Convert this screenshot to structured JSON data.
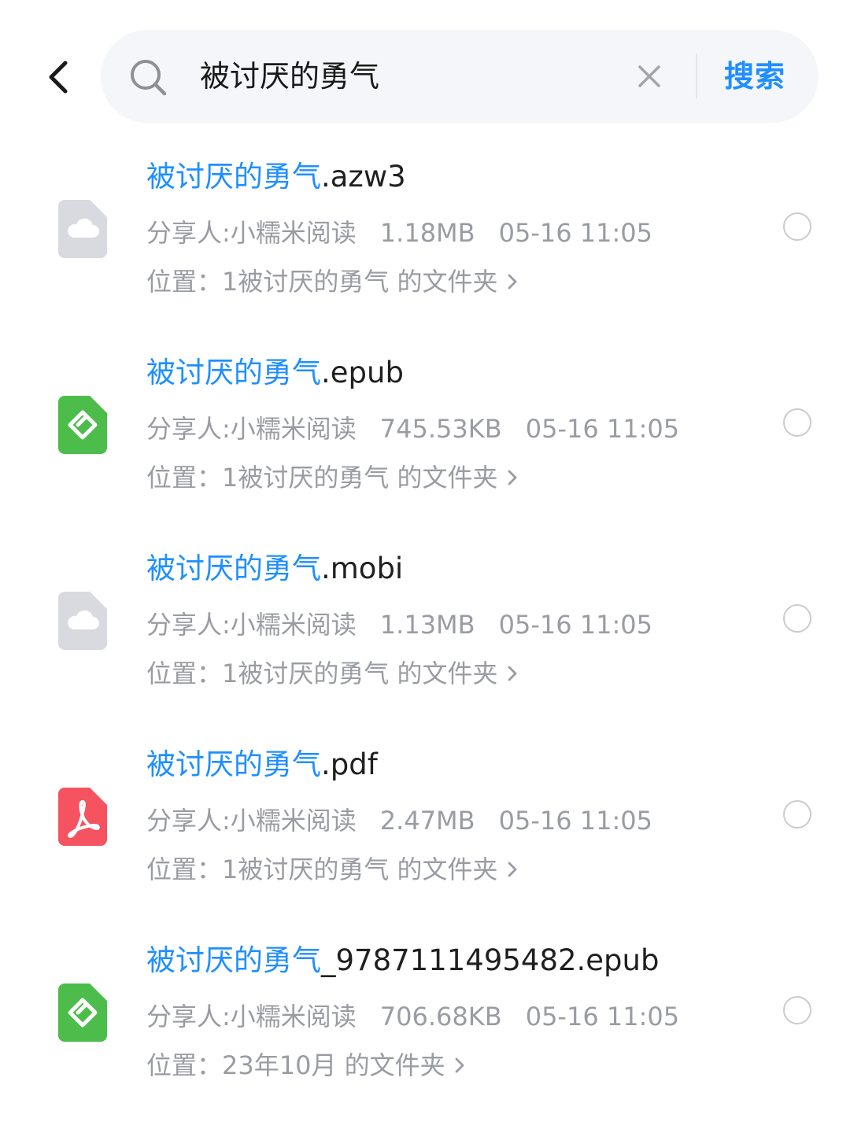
{
  "search": {
    "query": "被讨厌的勇气",
    "button_label": "搜索"
  },
  "icons": {
    "back": "chevron-left-icon",
    "search": "search-icon",
    "clear": "close-icon",
    "location_arrow": "chevron-right-icon",
    "radio": "radio-unchecked-icon"
  },
  "colors": {
    "accent": "#1f8fff",
    "meta_text": "#9a9ca3",
    "title_text": "#1f1f1f",
    "cloud_file": "#d9dadf",
    "epub_file": "#4cbd4a",
    "pdf_file": "#f5535f"
  },
  "files": [
    {
      "title_highlight": "被讨厌的勇气",
      "title_rest": ".azw3",
      "type_icon": "cloud-file-icon",
      "sharer": "分享人:小糯米阅读",
      "size": "1.18MB",
      "time": "05-16 11:05",
      "location_label": "位置：",
      "location": "1被讨厌的勇气 的文件夹"
    },
    {
      "title_highlight": "被讨厌的勇气",
      "title_rest": ".epub",
      "type_icon": "epub-file-icon",
      "sharer": "分享人:小糯米阅读",
      "size": "745.53KB",
      "time": "05-16 11:05",
      "location_label": "位置：",
      "location": "1被讨厌的勇气 的文件夹"
    },
    {
      "title_highlight": "被讨厌的勇气",
      "title_rest": ".mobi",
      "type_icon": "cloud-file-icon",
      "sharer": "分享人:小糯米阅读",
      "size": "1.13MB",
      "time": "05-16 11:05",
      "location_label": "位置：",
      "location": "1被讨厌的勇气 的文件夹"
    },
    {
      "title_highlight": "被讨厌的勇气",
      "title_rest": ".pdf",
      "type_icon": "pdf-file-icon",
      "sharer": "分享人:小糯米阅读",
      "size": "2.47MB",
      "time": "05-16 11:05",
      "location_label": "位置：",
      "location": "1被讨厌的勇气 的文件夹"
    },
    {
      "title_highlight": "被讨厌的勇气",
      "title_rest": "_9787111495482.epub",
      "type_icon": "epub-file-icon",
      "sharer": "分享人:小糯米阅读",
      "size": "706.68KB",
      "time": "05-16 11:05",
      "location_label": "位置：",
      "location": "23年10月 的文件夹"
    }
  ]
}
